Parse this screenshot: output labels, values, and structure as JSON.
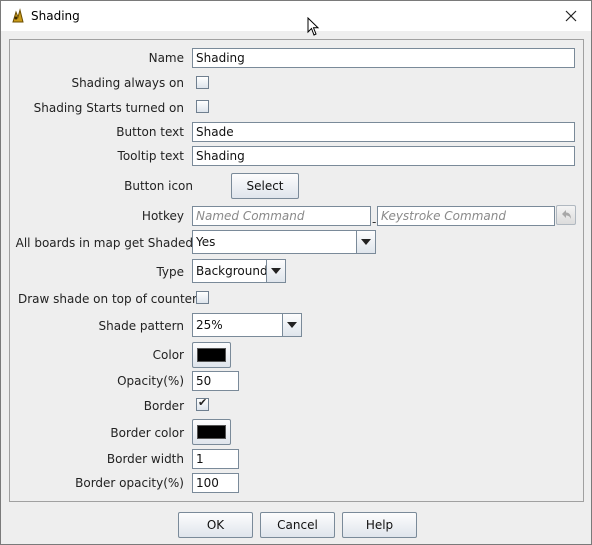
{
  "window": {
    "title": "Shading",
    "close_glyph": "✕"
  },
  "form": {
    "name": {
      "label": "Name",
      "value": "Shading"
    },
    "always_on": {
      "label": "Shading always on",
      "checked": false
    },
    "starts_on": {
      "label": "Shading Starts turned on",
      "checked": false
    },
    "button_text": {
      "label": "Button text",
      "value": "Shade"
    },
    "tooltip_text": {
      "label": "Tooltip text",
      "value": "Shading"
    },
    "button_icon": {
      "label": "Button icon",
      "select_label": "Select"
    },
    "hotkey": {
      "label": "Hotkey",
      "named_placeholder": "Named Command",
      "keystroke_placeholder": "Keystroke Command",
      "separator": "-"
    },
    "all_boards": {
      "label": "All boards in map get Shaded",
      "value": "Yes"
    },
    "type": {
      "label": "Type",
      "value": "Background"
    },
    "draw_on_top": {
      "label": "Draw shade on top of counters",
      "checked": false
    },
    "shade_pattern": {
      "label": "Shade pattern",
      "value": "25%"
    },
    "color": {
      "label": "Color",
      "swatch": "#000000"
    },
    "opacity": {
      "label": "Opacity(%)",
      "value": "50"
    },
    "border": {
      "label": "Border",
      "checked": true
    },
    "border_color": {
      "label": "Border color",
      "swatch": "#000000"
    },
    "border_width": {
      "label": "Border width",
      "value": "1"
    },
    "border_opacity": {
      "label": "Border opacity(%)",
      "value": "100"
    }
  },
  "buttons": {
    "ok": "OK",
    "cancel": "Cancel",
    "help": "Help"
  },
  "colors": {
    "accent": "#4a7ab0",
    "window_bg": "#eeeeee"
  }
}
